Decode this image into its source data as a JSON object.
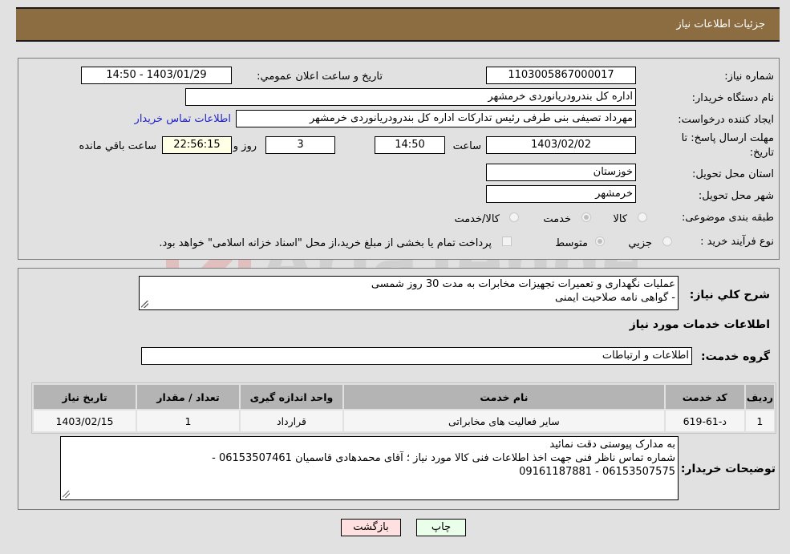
{
  "header": {
    "title": "جزئیات اطلاعات نیاز"
  },
  "form": {
    "need_number": {
      "label": "شماره نیاز:",
      "value": "1103005867000017"
    },
    "announce_datetime": {
      "label": "تاریخ و ساعت اعلان عمومي:",
      "value": "1403/01/29 - 14:50"
    },
    "buyer_org": {
      "label": "نام دستگاه خريدار:",
      "value": "اداره کل بندرودریانوردی خرمشهر"
    },
    "requester": {
      "label": "ايجاد کننده درخواست:",
      "value": "مهرداد  تصیفی بنی طرفی رئیس تدارکات اداره کل بندرودریانوردی خرمشهر"
    },
    "buyer_contact_link": "اطلاعات تماس خريدار",
    "deadline": {
      "label": "مهلت ارسال پاسخ: تا تاریخ:",
      "date": "1403/02/02",
      "time_label": "ساعت",
      "time": "14:50",
      "days": "3",
      "days_label": "روز و",
      "remaining": "22:56:15",
      "remaining_label": "ساعت باقي مانده"
    },
    "province": {
      "label": "استان محل تحویل:",
      "value": "خوزستان"
    },
    "city": {
      "label": "شهر محل تحویل:",
      "value": "خرمشهر"
    },
    "category": {
      "label": "طبقه بندی موضوعی:",
      "options": [
        {
          "label": "کالا",
          "checked": false
        },
        {
          "label": "خدمت",
          "checked": true
        },
        {
          "label": "کالا/خدمت",
          "checked": false
        }
      ]
    },
    "purchase_type": {
      "label": "نوع فرآیند خرید :",
      "options": [
        {
          "label": "جزيي",
          "checked": false
        },
        {
          "label": "متوسط",
          "checked": true
        }
      ],
      "treasury_note": "پرداخت تمام یا بخشی از مبلغ خرید،از محل \"اسناد خزانه اسلامی\" خواهد بود.",
      "treasury_checked": false
    }
  },
  "details": {
    "description_label": "شرح کلي نياز:",
    "description_lines": [
      "عملیات نگهداری و تعمیرات تجهیزات مخابرات به مدت 30 روز شمسی",
      "- گواهی نامه صلاحیت ایمنی"
    ],
    "services_title": "اطلاعات خدمات مورد نياز",
    "service_group_label": "گروه خدمت:",
    "service_group_value": "اطلاعات و ارتباطات",
    "table": {
      "headers": [
        "رديف",
        "کد خدمت",
        "نام خدمت",
        "واحد اندازه گيری",
        "تعداد / مقدار",
        "تاريخ نياز"
      ],
      "rows": [
        [
          "1",
          "د-61-619",
          "سایر فعالیت های مخابراتی",
          "قرارداد",
          "1",
          "1403/02/15"
        ]
      ]
    },
    "buyer_notes_label": "توضيحات خريدار:",
    "buyer_notes_lines": [
      "به مدارک پیوستی دقت نمائید",
      "شماره تماس ناظر فنی جهت اخذ اطلاعات فنی کالا مورد نیاز ؛ آقای محمدهادی قاسمیان   06153507461 -",
      "06153507575  -  09161187881"
    ]
  },
  "buttons": {
    "print": "چاپ",
    "back": "بازگشت"
  },
  "colors": {
    "header_bg": "#8c6c41",
    "print_bg": "#eaffea",
    "back_bg": "#ffe0e0",
    "link": "#2222cc"
  }
}
